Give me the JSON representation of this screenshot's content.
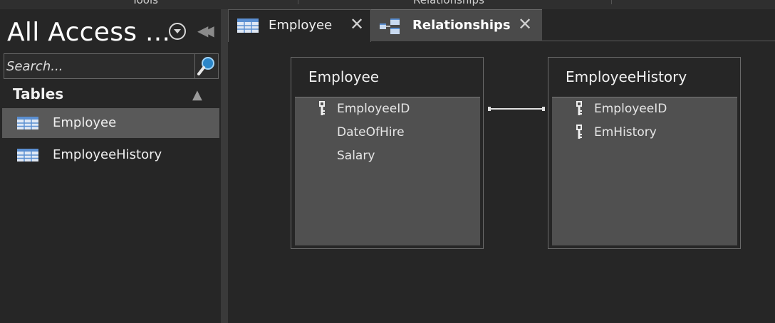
{
  "ribbon": {
    "tabs": [
      "Tools",
      "Relationships"
    ]
  },
  "nav": {
    "title": "All Access ...",
    "search_placeholder": "Search...",
    "group": "Tables",
    "items": [
      {
        "label": "Employee",
        "selected": true
      },
      {
        "label": "EmployeeHistory",
        "selected": false
      }
    ]
  },
  "tabs": [
    {
      "label": "Employee",
      "close": "✕",
      "active": true
    },
    {
      "label": "Relationships",
      "close": "✕",
      "active": false
    }
  ],
  "tables": [
    {
      "title": "Employee",
      "fields": [
        {
          "name": "EmployeeID",
          "key": true
        },
        {
          "name": "DateOfHire",
          "key": false
        },
        {
          "name": "Salary",
          "key": false
        }
      ]
    },
    {
      "title": "EmployeeHistory",
      "fields": [
        {
          "name": "EmployeeID",
          "key": true
        },
        {
          "name": "EmHistory",
          "key": true
        }
      ]
    }
  ],
  "icons": [
    "table-icon",
    "relationships-icon",
    "key-icon",
    "search-icon",
    "dropdown-icon",
    "collapse-icon",
    "close-icon"
  ],
  "colors": {
    "selected": "#595959",
    "canvas": "#262626",
    "field_list": "#505050",
    "search_icon": "#4aa3df"
  }
}
